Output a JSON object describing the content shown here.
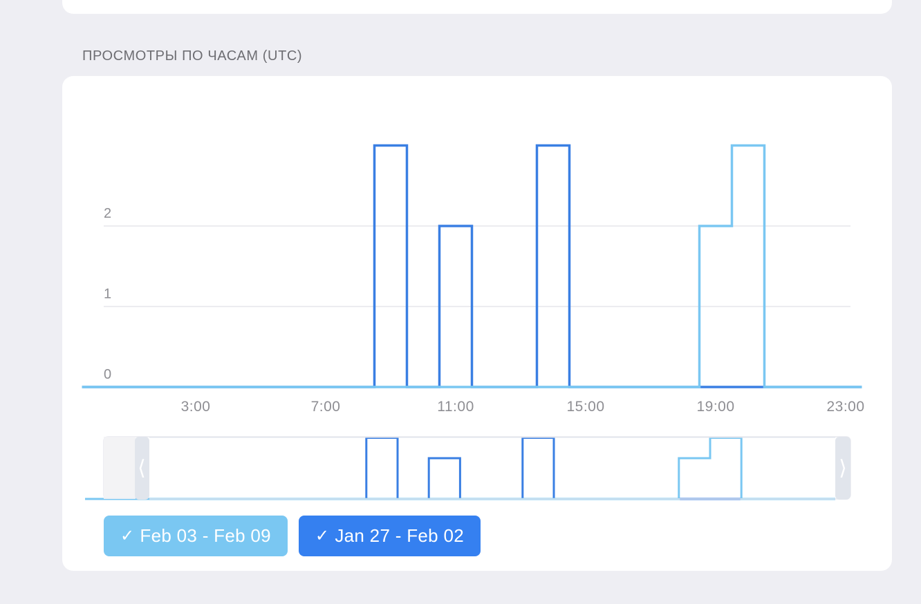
{
  "section_title": "ПРОСМОТРЫ ПО ЧАСАМ (UTC)",
  "colors": {
    "series_a": "#7ac7f2",
    "series_b": "#3a7fe3",
    "grid": "#e6e6ea",
    "tick": "#8e8e93"
  },
  "legend": [
    {
      "check": "✓",
      "label": "Feb 03 - Feb 09",
      "color": "#7ac7f2"
    },
    {
      "check": "✓",
      "label": "Jan 27 - Feb 02",
      "color": "#3580f0"
    }
  ],
  "chart_data": {
    "type": "line",
    "step": true,
    "x_ticks": [
      "3:00",
      "7:00",
      "11:00",
      "15:00",
      "19:00",
      "23:00"
    ],
    "y_ticks": [
      "0",
      "1",
      "2"
    ],
    "ylim": [
      0,
      3
    ],
    "categories": [
      "0:00",
      "1:00",
      "2:00",
      "3:00",
      "4:00",
      "5:00",
      "6:00",
      "7:00",
      "8:00",
      "9:00",
      "10:00",
      "11:00",
      "12:00",
      "13:00",
      "14:00",
      "15:00",
      "16:00",
      "17:00",
      "18:00",
      "19:00",
      "20:00",
      "21:00",
      "22:00",
      "23:00"
    ],
    "series": [
      {
        "name": "Feb 03 - Feb 09",
        "values": [
          0,
          0,
          0,
          0,
          0,
          0,
          0,
          0,
          0,
          0,
          0,
          0,
          0,
          0,
          0,
          0,
          0,
          0,
          0,
          2,
          3,
          0,
          0,
          0
        ]
      },
      {
        "name": "Jan 27 - Feb 02",
        "values": [
          0,
          0,
          0,
          0,
          0,
          0,
          0,
          0,
          0,
          3,
          0,
          2,
          0,
          0,
          3,
          0,
          0,
          0,
          0,
          0,
          0,
          0,
          0,
          0
        ]
      }
    ],
    "grid": true
  }
}
